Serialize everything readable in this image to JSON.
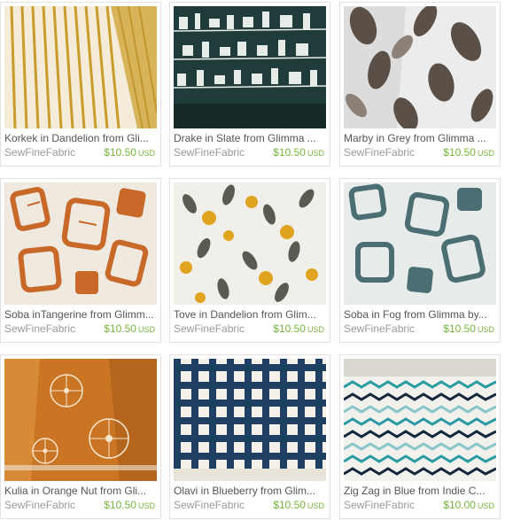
{
  "listings": [
    {
      "title": "Korkek in Dandelion from Gli...",
      "shop": "SewFineFabric",
      "price": "$10.50",
      "currency": "USD",
      "thumb_icon": "mustard-stripe-fabric"
    },
    {
      "title": "Drake in Slate from Glimma ...",
      "shop": "SewFineFabric",
      "price": "$10.50",
      "currency": "USD",
      "thumb_icon": "slate-dash-fabric"
    },
    {
      "title": "Marby in Grey from Glimma ...",
      "shop": "SewFineFabric",
      "price": "$10.50",
      "currency": "USD",
      "thumb_icon": "grey-leaf-fabric"
    },
    {
      "title": "Soba inTangerine from Glimm...",
      "shop": "SewFineFabric",
      "price": "$10.50",
      "currency": "USD",
      "thumb_icon": "orange-square-fabric"
    },
    {
      "title": "Tove in Dandelion from Glim...",
      "shop": "SewFineFabric",
      "price": "$10.50",
      "currency": "USD",
      "thumb_icon": "dot-leaf-fabric"
    },
    {
      "title": "Soba in Fog from Glimma by...",
      "shop": "SewFineFabric",
      "price": "$10.50",
      "currency": "USD",
      "thumb_icon": "fog-square-fabric"
    },
    {
      "title": "Kulia in Orange Nut from Gli...",
      "shop": "SewFineFabric",
      "price": "$10.50",
      "currency": "USD",
      "thumb_icon": "orange-burst-fabric"
    },
    {
      "title": "Olavi in Blueberry from Glim...",
      "shop": "SewFineFabric",
      "price": "$10.50",
      "currency": "USD",
      "thumb_icon": "blue-grid-fabric"
    },
    {
      "title": "Zig Zag in Blue from Indie C...",
      "shop": "SewFineFabric",
      "price": "$10.00",
      "currency": "USD",
      "thumb_icon": "blue-zigzag-fabric"
    }
  ],
  "colors": {
    "price": "#78b43c",
    "shop": "#999999",
    "title": "#555555"
  }
}
